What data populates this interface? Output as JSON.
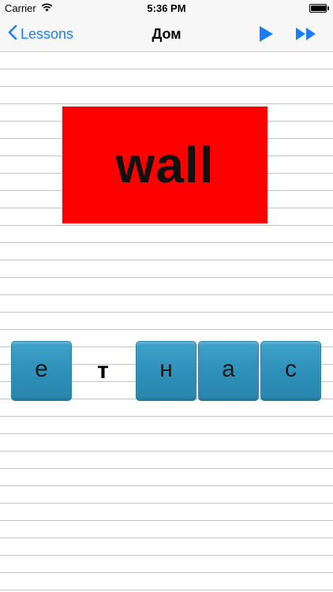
{
  "status_bar": {
    "carrier": "Carrier",
    "time": "5:36 PM"
  },
  "nav": {
    "back_label": "Lessons",
    "title": "Дом",
    "accent_color": "#1a7ef8"
  },
  "word_card": {
    "word": "wall",
    "background_color": "#ff0000"
  },
  "letters": [
    {
      "char": "е",
      "style": "tile"
    },
    {
      "char": "т",
      "style": "plain"
    },
    {
      "char": "н",
      "style": "tile"
    },
    {
      "char": "а",
      "style": "tile"
    },
    {
      "char": "с",
      "style": "tile"
    }
  ]
}
